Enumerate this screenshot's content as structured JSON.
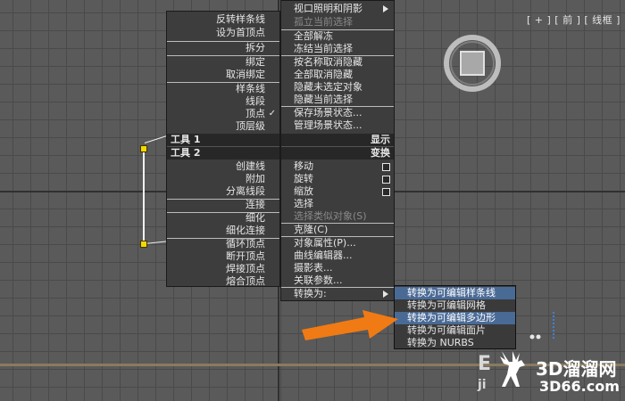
{
  "viewport": {
    "label": "[ + ] [ 前 ] [ 线框 ]",
    "background_fragment_1": "E",
    "background_fragment_2": "ji"
  },
  "left_menu": {
    "group1": [
      {
        "label": "反转样条线"
      },
      {
        "label": "设为首顶点"
      },
      {
        "label": "拆分"
      },
      {
        "label": "绑定"
      },
      {
        "label": "取消绑定"
      },
      {
        "label": "样条线"
      },
      {
        "label": "线段"
      },
      {
        "label": "顶点",
        "checked": true
      },
      {
        "label": "顶层级"
      }
    ],
    "tools1_title": "工具 1",
    "tools2_title": "工具 2",
    "group2": [
      {
        "label": "创建线"
      },
      {
        "label": "附加"
      },
      {
        "label": "分离线段"
      },
      {
        "label": "连接"
      },
      {
        "label": "细化"
      },
      {
        "label": "细化连接"
      },
      {
        "label": "循环顶点"
      },
      {
        "label": "断开顶点"
      },
      {
        "label": "焊接顶点"
      },
      {
        "label": "熔合顶点"
      }
    ],
    "check_glyph": "✓"
  },
  "right_menu": {
    "group1": [
      {
        "label": "视口照明和阴影",
        "submenu": true
      },
      {
        "label": "孤立当前选择",
        "disabled": true
      },
      {
        "label": "全部解冻"
      },
      {
        "label": "冻结当前选择"
      },
      {
        "label": "按名称取消隐藏"
      },
      {
        "label": "全部取消隐藏"
      },
      {
        "label": "隐藏未选定对象"
      },
      {
        "label": "隐藏当前选择"
      },
      {
        "label": "保存场景状态..."
      },
      {
        "label": "管理场景状态..."
      }
    ],
    "display_title": "显示",
    "transform_title": "变换",
    "group2": [
      {
        "label": "移动",
        "box": true
      },
      {
        "label": "旋转",
        "box": true
      },
      {
        "label": "缩放",
        "box": true
      },
      {
        "label": "选择"
      },
      {
        "label": "选择类似对象(S)",
        "disabled": true
      },
      {
        "label": "克隆(C)"
      },
      {
        "label": "对象属性(P)..."
      },
      {
        "label": "曲线编辑器..."
      },
      {
        "label": "摄影表..."
      },
      {
        "label": "关联参数..."
      },
      {
        "label": "转换为:",
        "submenu": true
      }
    ]
  },
  "submenu": {
    "items": [
      {
        "label": "转换为可编辑样条线",
        "highlighted": true
      },
      {
        "label": "转换为可编辑网格"
      },
      {
        "label": "转换为可编辑多边形",
        "highlighted": true
      },
      {
        "label": "转换为可编辑面片"
      },
      {
        "label": "转换为 NURBS"
      }
    ]
  },
  "watermark": {
    "brand": "3D溜溜网",
    "url": "3D66.com"
  },
  "colors": {
    "accent_orange": "#f07a14",
    "vertex_yellow": "#f4d800",
    "menu_bg": "#3d3d3d",
    "title_bar": "#272727"
  }
}
